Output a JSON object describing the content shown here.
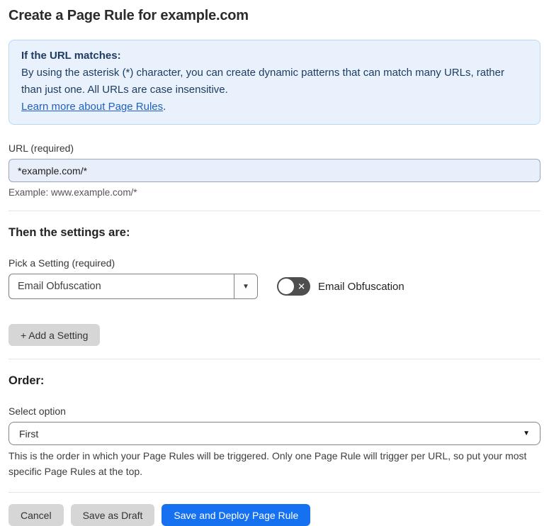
{
  "page": {
    "title": "Create a Page Rule for example.com"
  },
  "info_box": {
    "heading": "If the URL matches:",
    "body": "By using the asterisk (*) character, you can create dynamic patterns that can match many URLs, rather than just one. All URLs are case insensitive.",
    "link_label": "Learn more about Page Rules",
    "link_suffix": "."
  },
  "url_field": {
    "label": "URL (required)",
    "value": "*example.com/*",
    "example": "Example: www.example.com/*"
  },
  "settings": {
    "heading": "Then the settings are:",
    "pick_label": "Pick a Setting (required)",
    "selected_setting": "Email Obfuscation",
    "dropdown_arrow_icon": "▼",
    "toggle_state": "off",
    "toggle_icon": "✕",
    "toggle_label": "Email Obfuscation",
    "add_button_label": "+ Add a Setting"
  },
  "order": {
    "heading": "Order:",
    "select_label": "Select option",
    "selected_option": "First",
    "select_arrow_icon": "▼",
    "description": "This is the order in which your Page Rules will be triggered. Only one Page Rule will trigger per URL, so put your most specific Page Rules at the top."
  },
  "footer": {
    "cancel_label": "Cancel",
    "save_draft_label": "Save as Draft",
    "save_deploy_label": "Save and Deploy Page Rule"
  },
  "colors": {
    "accent_blue": "#1671f0",
    "info_box_bg": "#e9f2fc",
    "info_box_border": "#bcd7f1",
    "info_text": "#1e3c63",
    "link_blue": "#2160c4",
    "url_input_bg": "#e9eefb",
    "toggle_off_bg": "#4e4e4e",
    "gray_button_bg": "#d6d6d6"
  }
}
